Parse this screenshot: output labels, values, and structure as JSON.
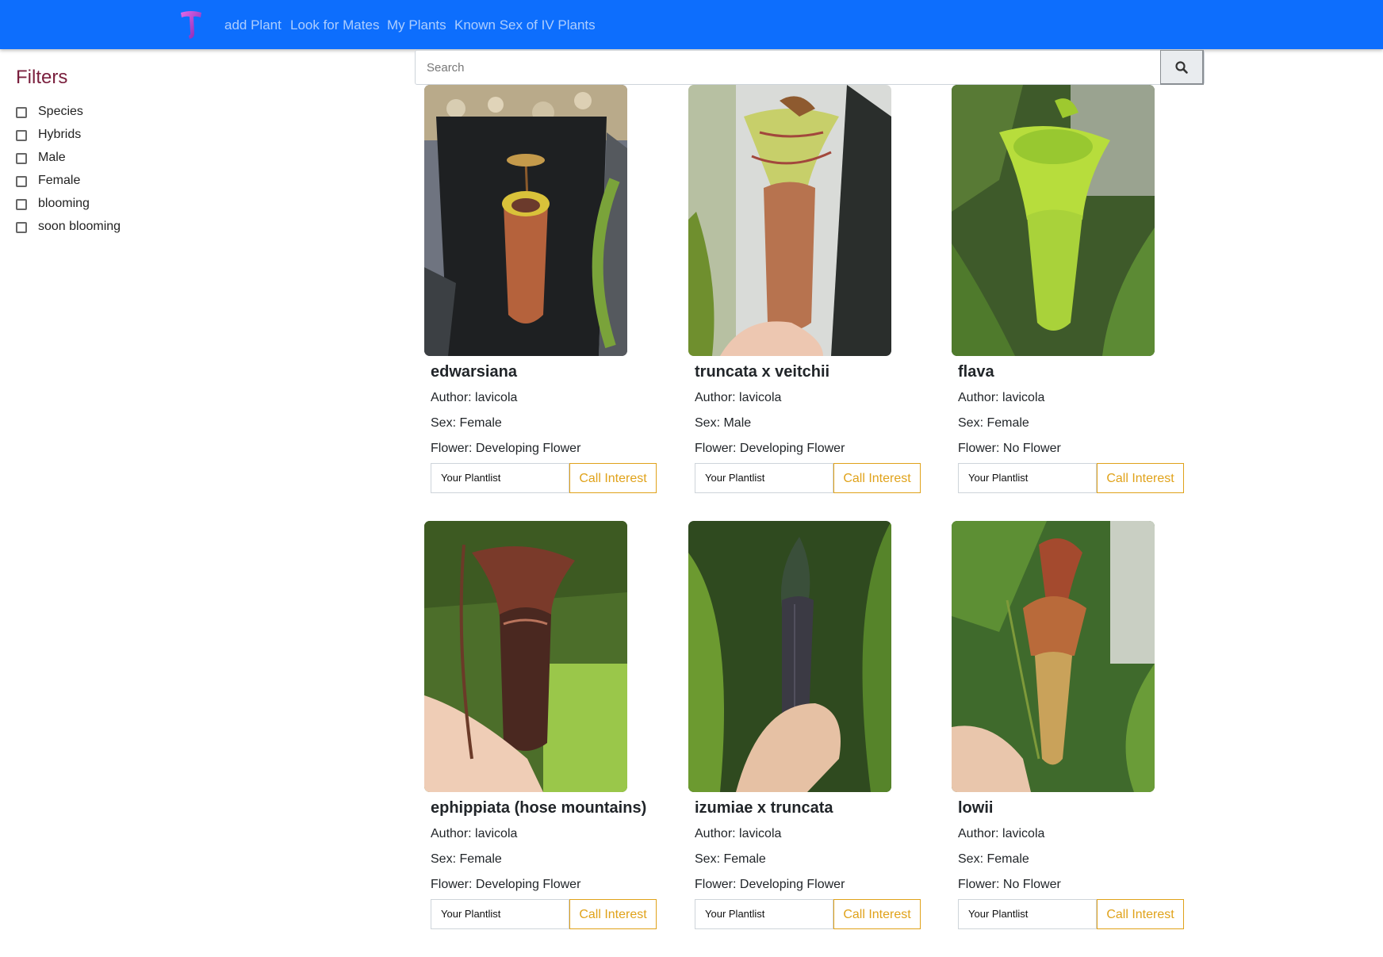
{
  "nav": {
    "links": [
      "add Plant",
      "Look for Mates",
      "My Plants",
      "Known Sex of IV Plants"
    ],
    "color": "#0d6efd"
  },
  "filters": {
    "title": "Filters",
    "options": [
      "Species",
      "Hybrids",
      "Male",
      "Female",
      "blooming",
      "soon blooming"
    ]
  },
  "search": {
    "placeholder": "Search"
  },
  "cards": [
    {
      "title": "edwarsiana",
      "author": "Author: lavicola",
      "sex": "Sex: Female",
      "flower": "Flower: Developing Flower",
      "plantlist": "Your Plantlist",
      "button": "Call Interest"
    },
    {
      "title": "truncata x veitchii",
      "author": "Author: lavicola",
      "sex": "Sex: Male",
      "flower": "Flower: Developing Flower",
      "plantlist": "Your Plantlist",
      "button": "Call Interest"
    },
    {
      "title": "flava",
      "author": "Author: lavicola",
      "sex": "Sex: Female",
      "flower": "Flower: No Flower",
      "plantlist": "Your Plantlist",
      "button": "Call Interest"
    },
    {
      "title": "ephippiata (hose mountains)",
      "author": "Author: lavicola",
      "sex": "Sex: Female",
      "flower": "Flower: Developing Flower",
      "plantlist": "Your Plantlist",
      "button": "Call Interest"
    },
    {
      "title": "izumiae x truncata",
      "author": "Author: lavicola",
      "sex": "Sex: Female",
      "flower": "Flower: Developing Flower",
      "plantlist": "Your Plantlist",
      "button": "Call Interest"
    },
    {
      "title": "lowii",
      "author": "Author: lavicola",
      "sex": "Sex: Female",
      "flower": "Flower: No Flower",
      "plantlist": "Your Plantlist",
      "button": "Call Interest"
    }
  ]
}
